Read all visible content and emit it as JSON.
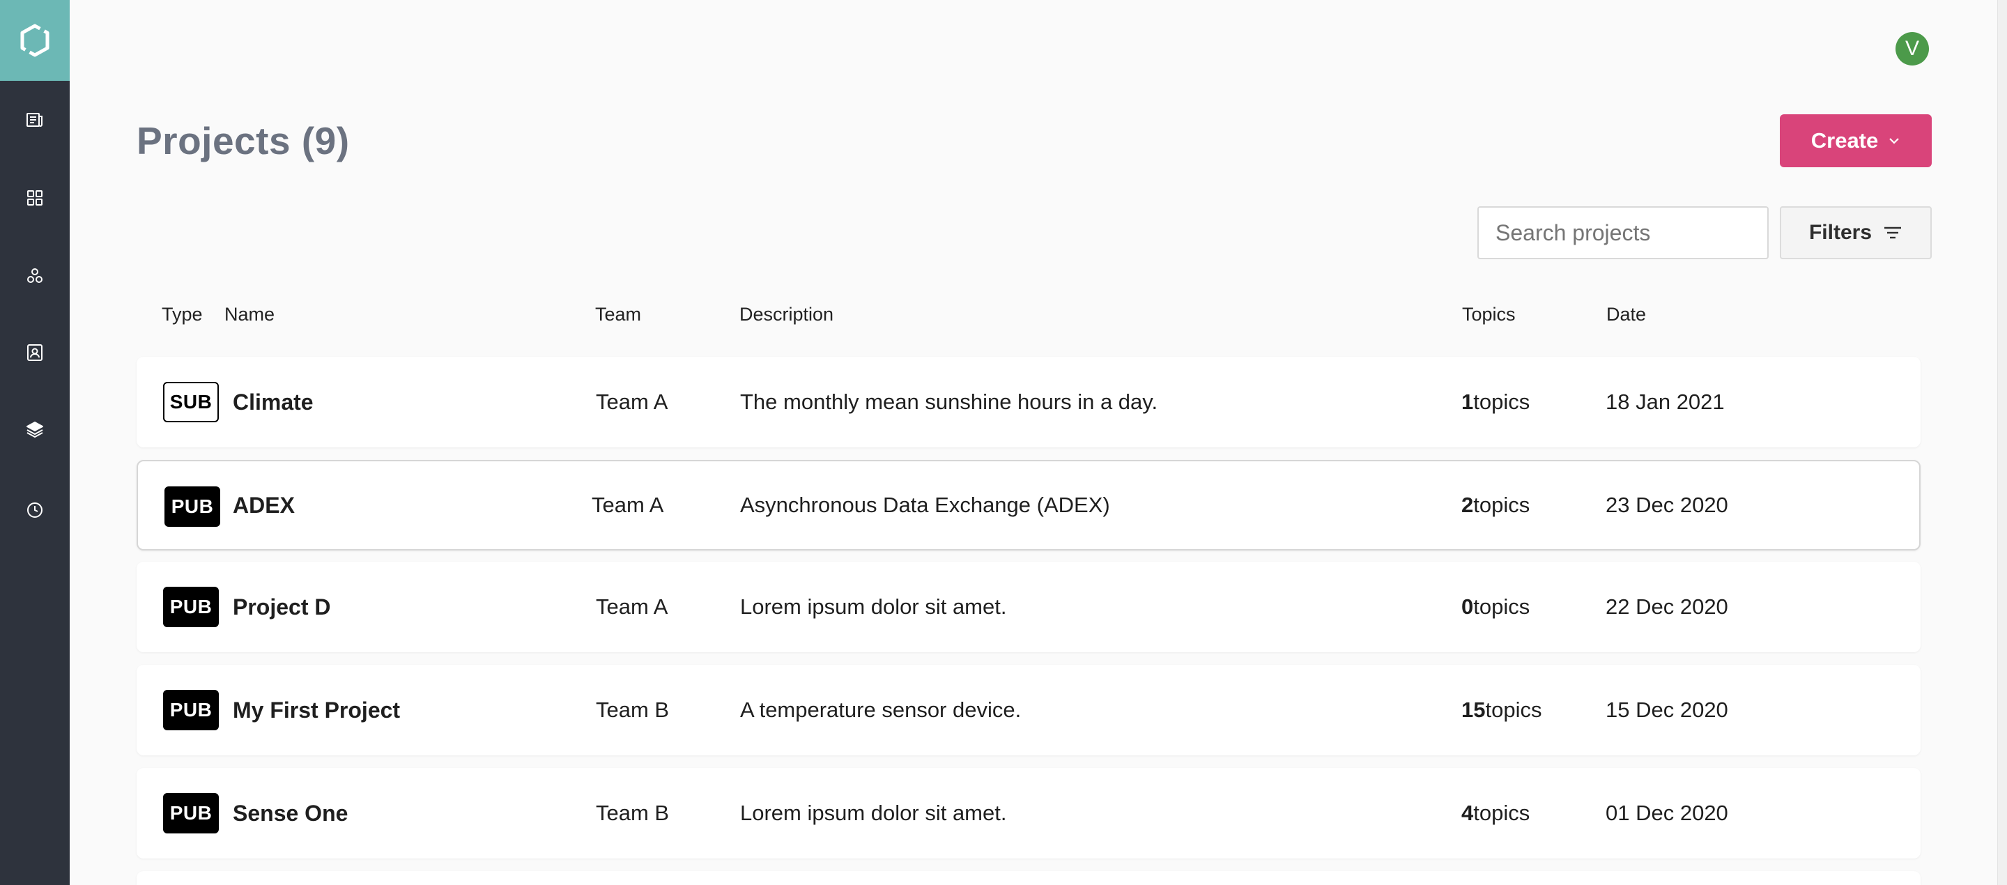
{
  "header": {
    "user_initial": "V",
    "title": "Projects (9)",
    "create_label": "Create"
  },
  "toolbar": {
    "search_placeholder": "Search projects",
    "filters_label": "Filters"
  },
  "sidebar": {
    "items": [
      {
        "icon": "newspaper-icon"
      },
      {
        "icon": "grid-icon"
      },
      {
        "icon": "molecule-icon"
      },
      {
        "icon": "contact-card-icon"
      },
      {
        "icon": "layers-icon"
      },
      {
        "icon": "clock-icon"
      }
    ]
  },
  "table": {
    "columns": {
      "type": "Type",
      "name": "Name",
      "team": "Team",
      "description": "Description",
      "topics": "Topics",
      "date": "Date"
    },
    "topics_suffix": "topics",
    "rows": [
      {
        "type": "SUB",
        "name": "Climate",
        "team": "Team A",
        "description": "The monthly mean sunshine hours in a day.",
        "topics": "1",
        "date": "18 Jan 2021"
      },
      {
        "type": "PUB",
        "name": "ADEX",
        "team": "Team A",
        "description": "Asynchronous Data Exchange (ADEX)",
        "topics": "2",
        "date": "23 Dec 2020"
      },
      {
        "type": "PUB",
        "name": "Project D",
        "team": "Team A",
        "description": "Lorem ipsum dolor sit amet.",
        "topics": "0",
        "date": "22 Dec 2020"
      },
      {
        "type": "PUB",
        "name": "My First Project",
        "team": "Team B",
        "description": "A temperature sensor device.",
        "topics": "15",
        "date": "15 Dec 2020"
      },
      {
        "type": "PUB",
        "name": "Sense One",
        "team": "Team B",
        "description": "Lorem ipsum dolor sit amet.",
        "topics": "4",
        "date": "01 Dec 2020"
      }
    ]
  },
  "colors": {
    "sidebar": "#2e333d",
    "logo_bg": "#6cb8b5",
    "create": "#d9447a",
    "avatar": "#4c9a4a"
  }
}
